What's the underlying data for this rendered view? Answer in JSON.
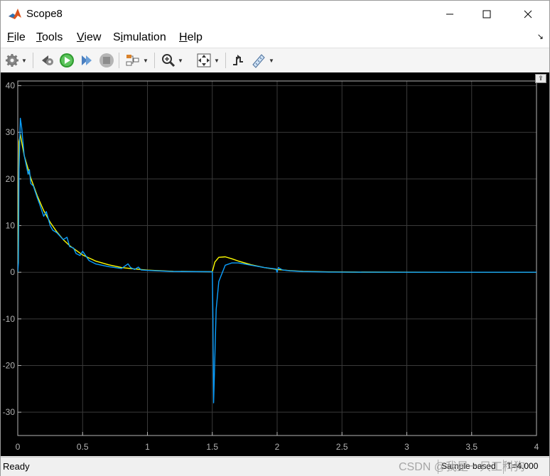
{
  "window": {
    "title": "Scope8"
  },
  "menu": {
    "items": [
      {
        "label": "File",
        "accel": "F"
      },
      {
        "label": "Tools",
        "accel": "T"
      },
      {
        "label": "View",
        "accel": "V"
      },
      {
        "label": "Simulation",
        "accel": "i"
      },
      {
        "label": "Help",
        "accel": "H"
      }
    ]
  },
  "toolbar": {
    "icons": [
      "settings-icon",
      "step-back-icon",
      "run-icon",
      "step-forward-icon",
      "stop-icon",
      "signal-selector-icon",
      "zoom-icon",
      "fit-axes-icon",
      "triggers-icon",
      "measurements-icon"
    ]
  },
  "status": {
    "ready": "Ready",
    "mode": "Sample based",
    "time": "T=4.000"
  },
  "watermark": "CSDN @我是一只工科狗",
  "colors": {
    "background": "#000000",
    "grid": "#3a3a3a",
    "axis": "#b4b4b4",
    "series_yellow": "#ffff00",
    "series_blue": "#0a9fff"
  },
  "chart_data": {
    "type": "line",
    "xlim": [
      0,
      4
    ],
    "ylim": [
      -35,
      41
    ],
    "xticks": [
      0,
      0.5,
      1,
      1.5,
      2,
      2.5,
      3,
      3.5,
      4
    ],
    "xtick_labels": [
      "0",
      "0.5",
      "1",
      "1.5",
      "2",
      "2.5",
      "3",
      "3.5",
      "4"
    ],
    "yticks": [
      -30,
      -20,
      -10,
      0,
      10,
      20,
      30,
      40
    ],
    "ytick_labels": [
      "-30",
      "-20",
      "-10",
      "0",
      "10",
      "20",
      "30",
      "40"
    ],
    "grid": true,
    "series": [
      {
        "color": "#ffff00",
        "x": [
          0,
          0.01,
          0.02,
          0.05,
          0.1,
          0.15,
          0.2,
          0.25,
          0.3,
          0.35,
          0.4,
          0.5,
          0.6,
          0.7,
          0.8,
          0.9,
          1.0,
          1.2,
          1.5,
          1.52,
          1.55,
          1.6,
          1.65,
          1.7,
          1.8,
          1.9,
          2.0,
          2.1,
          2.2,
          2.4,
          2.6,
          3.0,
          3.5,
          4.0
        ],
        "y": [
          0,
          28,
          29.5,
          25,
          20.2,
          16.4,
          13.2,
          10.7,
          8.7,
          7.0,
          5.7,
          3.7,
          2.4,
          1.6,
          1.0,
          0.7,
          0.45,
          0.2,
          0.1,
          2.2,
          3.2,
          3.3,
          2.9,
          2.4,
          1.6,
          1.0,
          0.6,
          0.35,
          0.2,
          0.08,
          0.03,
          0.01,
          0,
          0
        ]
      },
      {
        "color": "#0a9fff",
        "x": [
          0,
          0.005,
          0.01,
          0.02,
          0.03,
          0.05,
          0.08,
          0.09,
          0.1,
          0.12,
          0.15,
          0.17,
          0.2,
          0.22,
          0.25,
          0.27,
          0.3,
          0.35,
          0.38,
          0.4,
          0.43,
          0.45,
          0.48,
          0.5,
          0.55,
          0.6,
          0.7,
          0.8,
          0.85,
          0.87,
          0.9,
          0.93,
          0.95,
          1.0,
          1.2,
          1.5,
          1.505,
          1.51,
          1.52,
          1.53,
          1.55,
          1.6,
          1.65,
          1.7,
          1.8,
          1.9,
          1.99,
          2.0,
          2.01,
          2.02,
          2.04,
          2.1,
          2.2,
          2.4,
          2.6,
          3.0,
          3.5,
          4.0
        ],
        "y": [
          0,
          2,
          22,
          33,
          31,
          25,
          21,
          22,
          19,
          18.5,
          16,
          14.5,
          12,
          13,
          10,
          9,
          8.5,
          7,
          7.5,
          5.5,
          5.2,
          4,
          3.6,
          4.5,
          2.5,
          1.8,
          1.2,
          0.8,
          1.8,
          1.0,
          0.6,
          1.1,
          0.5,
          0.4,
          0.15,
          0.1,
          -10,
          -28,
          -18,
          -8,
          -2,
          1.5,
          2.0,
          2.0,
          1.5,
          1.0,
          0.7,
          0,
          1.0,
          0.8,
          0.5,
          0.3,
          0.15,
          0.05,
          0.02,
          0,
          0,
          0
        ]
      }
    ]
  }
}
